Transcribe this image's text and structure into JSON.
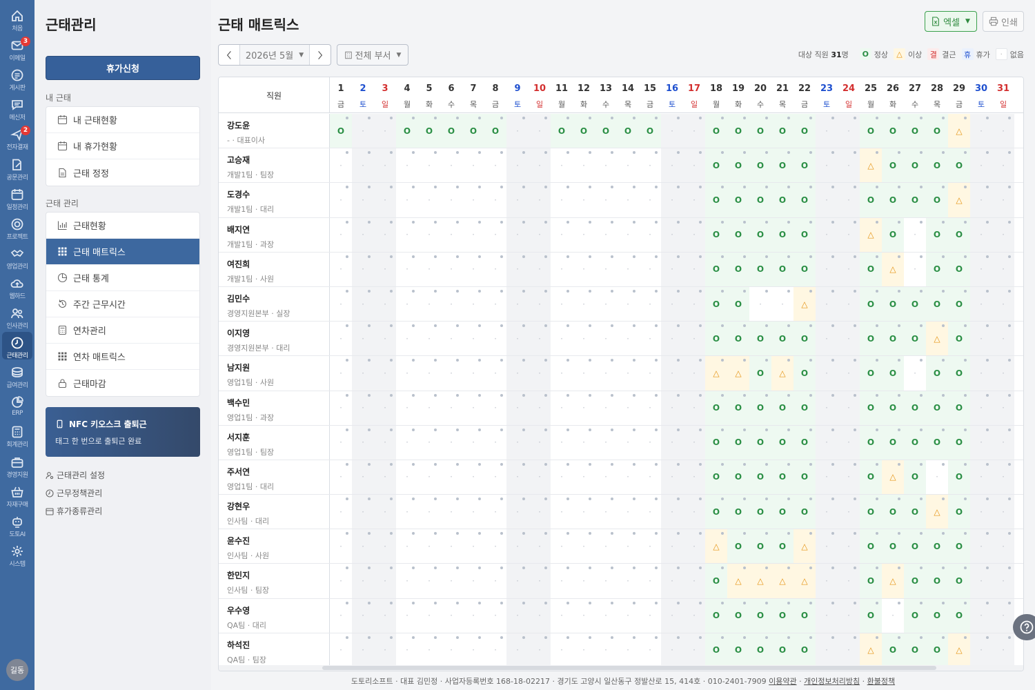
{
  "rail": [
    {
      "icon": "home-icon",
      "label": "처음"
    },
    {
      "icon": "mail-icon",
      "label": "이메일",
      "badge": "3"
    },
    {
      "icon": "board-icon",
      "label": "게시판"
    },
    {
      "icon": "chat-icon",
      "label": "메신저"
    },
    {
      "icon": "approval-icon",
      "label": "전자결재",
      "badge": "2"
    },
    {
      "icon": "document-edit-icon",
      "label": "공문관리"
    },
    {
      "icon": "calendar-icon",
      "label": "일정관리"
    },
    {
      "icon": "target-icon",
      "label": "프로젝트"
    },
    {
      "icon": "handshake-icon",
      "label": "영업관리"
    },
    {
      "icon": "cloud-icon",
      "label": "웹하드"
    },
    {
      "icon": "people-icon",
      "label": "인사관리"
    },
    {
      "icon": "clock-icon",
      "label": "근태관리",
      "active": true
    },
    {
      "icon": "coins-icon",
      "label": "급여관리"
    },
    {
      "icon": "pie-chart-icon",
      "label": "ERP"
    },
    {
      "icon": "calculator-icon",
      "label": "회계관리"
    },
    {
      "icon": "briefcase-icon",
      "label": "경영지원"
    },
    {
      "icon": "basket-icon",
      "label": "자재구매"
    },
    {
      "icon": "robot-icon",
      "label": "도토AI"
    },
    {
      "icon": "gear-icon",
      "label": "시스템"
    }
  ],
  "user": {
    "avatar": "길동"
  },
  "sidebar": {
    "title": "근태관리",
    "leave_button": "휴가신청",
    "my_section": "내 근태",
    "my_items": [
      {
        "label": "내 근태현황",
        "icon": "calendar-icon"
      },
      {
        "label": "내 휴가현황",
        "icon": "calendar-icon"
      },
      {
        "label": "근태 정정",
        "icon": "document-icon"
      }
    ],
    "admin_section": "근태 관리",
    "admin_items": [
      {
        "label": "근태현황",
        "icon": "bar-chart-icon"
      },
      {
        "label": "근태 매트릭스",
        "icon": "grid-icon",
        "active": true
      },
      {
        "label": "근태 통계",
        "icon": "pie-chart-icon"
      },
      {
        "label": "주간 근무시간",
        "icon": "history-icon"
      },
      {
        "label": "연차관리",
        "icon": "calculator-icon"
      },
      {
        "label": "연차 매트릭스",
        "icon": "grid-icon"
      },
      {
        "label": "근태마감",
        "icon": "lock-icon"
      }
    ],
    "nfc_title": "NFC 키오스크 출퇴근",
    "nfc_sub": "태그 한 번으로 출퇴근 완료",
    "settings_links": [
      "근태관리 설정",
      "근무정책관리",
      "휴가종류관리"
    ]
  },
  "page": {
    "title": "근태 매트릭스",
    "excel": "엑셀",
    "print": "인쇄",
    "month": "2026년 5월",
    "dept": "전체 부서",
    "target_label": "대상 직원",
    "target_count": "31",
    "target_unit": "명",
    "legend": [
      {
        "sym": "O",
        "label": "정상",
        "kind": "ok"
      },
      {
        "sym": "△",
        "label": "이상",
        "kind": "ab"
      },
      {
        "sym": "결",
        "label": "결근",
        "kind": "absent"
      },
      {
        "sym": "휴",
        "label": "휴가",
        "kind": "leave"
      },
      {
        "sym": "·",
        "label": "없음",
        "kind": "none"
      }
    ],
    "employee_header": "직원"
  },
  "colors": {
    "accent": "#3d689f",
    "ok": "#2b8f45",
    "warn": "#e59313",
    "sat": "#1e4fcf",
    "sun": "#d32f2f"
  },
  "days": [
    {
      "d": "1",
      "w": "금"
    },
    {
      "d": "2",
      "w": "토"
    },
    {
      "d": "3",
      "w": "일"
    },
    {
      "d": "4",
      "w": "월"
    },
    {
      "d": "5",
      "w": "화"
    },
    {
      "d": "6",
      "w": "수"
    },
    {
      "d": "7",
      "w": "목"
    },
    {
      "d": "8",
      "w": "금"
    },
    {
      "d": "9",
      "w": "토"
    },
    {
      "d": "10",
      "w": "일"
    },
    {
      "d": "11",
      "w": "월"
    },
    {
      "d": "12",
      "w": "화"
    },
    {
      "d": "13",
      "w": "수"
    },
    {
      "d": "14",
      "w": "목"
    },
    {
      "d": "15",
      "w": "금"
    },
    {
      "d": "16",
      "w": "토"
    },
    {
      "d": "17",
      "w": "일"
    },
    {
      "d": "18",
      "w": "월"
    },
    {
      "d": "19",
      "w": "화"
    },
    {
      "d": "20",
      "w": "수"
    },
    {
      "d": "21",
      "w": "목"
    },
    {
      "d": "22",
      "w": "금"
    },
    {
      "d": "23",
      "w": "토"
    },
    {
      "d": "24",
      "w": "일"
    },
    {
      "d": "25",
      "w": "월"
    },
    {
      "d": "26",
      "w": "화"
    },
    {
      "d": "27",
      "w": "수"
    },
    {
      "d": "28",
      "w": "목"
    },
    {
      "d": "29",
      "w": "금"
    },
    {
      "d": "30",
      "w": "토"
    },
    {
      "d": "31",
      "w": "일"
    }
  ],
  "employees": [
    {
      "name": "강도윤",
      "sub": "- · 대표이사",
      "marks": "O..OOOOO..OOOOO..OOOOO..OOOOA.."
    },
    {
      "name": "고승재",
      "sub": "개발1팀 · 팀장",
      "marks": ".................OOOOO..AOOOO.."
    },
    {
      "name": "도경수",
      "sub": "개발1팀 · 대리",
      "marks": ".................OOOOO..OOOOA.."
    },
    {
      "name": "배지연",
      "sub": "개발1팀 · 과장",
      "marks": ".................OOOOO..AO_OO.."
    },
    {
      "name": "여진희",
      "sub": "개발1팀 · 사원",
      "marks": ".................OOOOO..OA_OO.."
    },
    {
      "name": "김민수",
      "sub": "경영지원본부 · 실장",
      "marks": ".................OO__A..OOOOO.."
    },
    {
      "name": "이지영",
      "sub": "경영지원본부 · 대리",
      "marks": ".................OOOOO..OOOAO.."
    },
    {
      "name": "남지원",
      "sub": "영업1팀 · 사원",
      "marks": ".................AAOAO..OO_OO.."
    },
    {
      "name": "백수민",
      "sub": "영업1팀 · 과장",
      "marks": ".................OOOOO..OOOOO.."
    },
    {
      "name": "서지훈",
      "sub": "영업1팀 · 팀장",
      "marks": ".................OOOOO..OOOOO.."
    },
    {
      "name": "주서연",
      "sub": "영업1팀 · 대리",
      "marks": ".................OOOOO..OAO_O.."
    },
    {
      "name": "강현우",
      "sub": "인사팀 · 대리",
      "marks": ".................OOOOO..OOOAO.."
    },
    {
      "name": "윤수진",
      "sub": "인사팀 · 사원",
      "marks": ".................AOOOA..OOOOO.."
    },
    {
      "name": "한민지",
      "sub": "인사팀 · 팀장",
      "marks": ".................OAAAA..OAOOO.."
    },
    {
      "name": "우수영",
      "sub": "QA팀 · 대리",
      "marks": ".................OOOOO..O_OOO.."
    },
    {
      "name": "하석진",
      "sub": "QA팀 · 팀장",
      "marks": ".................OOOOO..AOOOA.."
    }
  ],
  "footer": {
    "text": "도토리소프트 · 대표 김민정 · 사업자등록번호 168-18-02217 · 경기도 고양시 일산동구 정발산로 15, 414호 · 010-2401-7909",
    "links": [
      "이용약관",
      "개인정보처리방침",
      "환불정책"
    ]
  }
}
